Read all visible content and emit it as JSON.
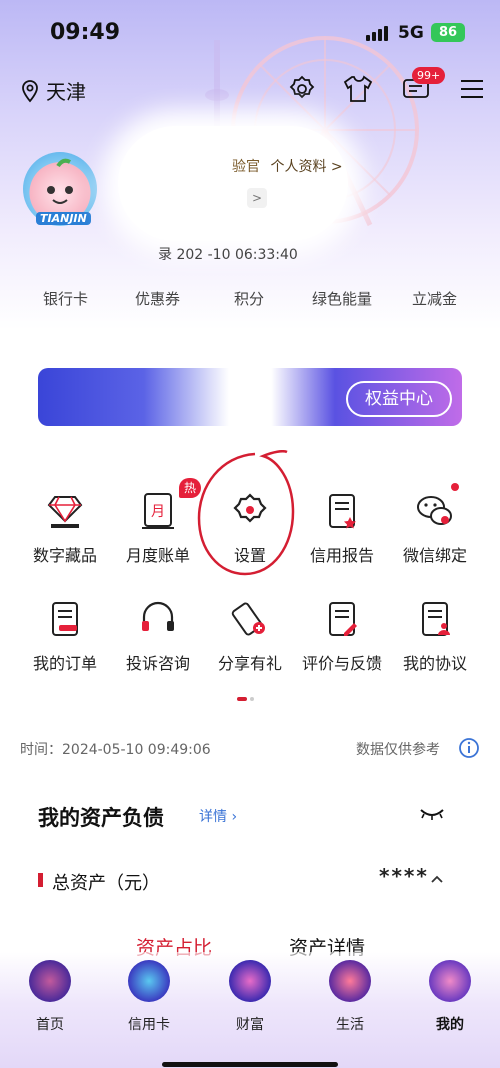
{
  "status_bar": {
    "time": "09:49",
    "network": "5G",
    "battery": "86"
  },
  "header": {
    "city": "天津",
    "message_badge": "99+"
  },
  "profile": {
    "avatar_tag": "TIANJIN",
    "level_text": "验官",
    "profile_link": "个人资料 >",
    "chevron": ">",
    "last_login": "录 202   -10 06:33:40"
  },
  "tabs": [
    "银行卡",
    "优惠券",
    "积分",
    "绿色能量",
    "立减金"
  ],
  "banner": {
    "button_label": "权益中心"
  },
  "services": {
    "row1": [
      {
        "label": "数字藏品",
        "icon": "gem-icon"
      },
      {
        "label": "月度账单",
        "icon": "monthly-bill-icon"
      },
      {
        "label": "设置",
        "icon": "gear-icon"
      },
      {
        "label": "信用报告",
        "icon": "credit-report-icon"
      },
      {
        "label": "微信绑定",
        "icon": "wechat-icon"
      }
    ],
    "row2": [
      {
        "label": "我的订单",
        "icon": "order-icon"
      },
      {
        "label": "投诉咨询",
        "icon": "headset-icon"
      },
      {
        "label": "分享有礼",
        "icon": "share-gift-icon"
      },
      {
        "label": "评价与反馈",
        "icon": "feedback-icon"
      },
      {
        "label": "我的协议",
        "icon": "agreement-icon"
      }
    ],
    "hot_badge": "热"
  },
  "info": {
    "time_text": "时间：2024-05-10 09:49:06",
    "note": "数据仅供参考"
  },
  "assets": {
    "title": "我的资产负债",
    "details_link": "详情",
    "total_label": "总资产（元）",
    "total_value": "****",
    "sub_tabs": [
      "资产占比",
      "资产详情"
    ]
  },
  "bottom_nav": [
    {
      "label": "首页",
      "active": false
    },
    {
      "label": "信用卡",
      "active": false
    },
    {
      "label": "财富",
      "active": false
    },
    {
      "label": "生活",
      "active": false
    },
    {
      "label": "我的",
      "active": true
    }
  ],
  "colors": {
    "brand_red": "#d41e32",
    "accent_purple": "#6a5be6",
    "link_blue": "#3b74d6"
  }
}
